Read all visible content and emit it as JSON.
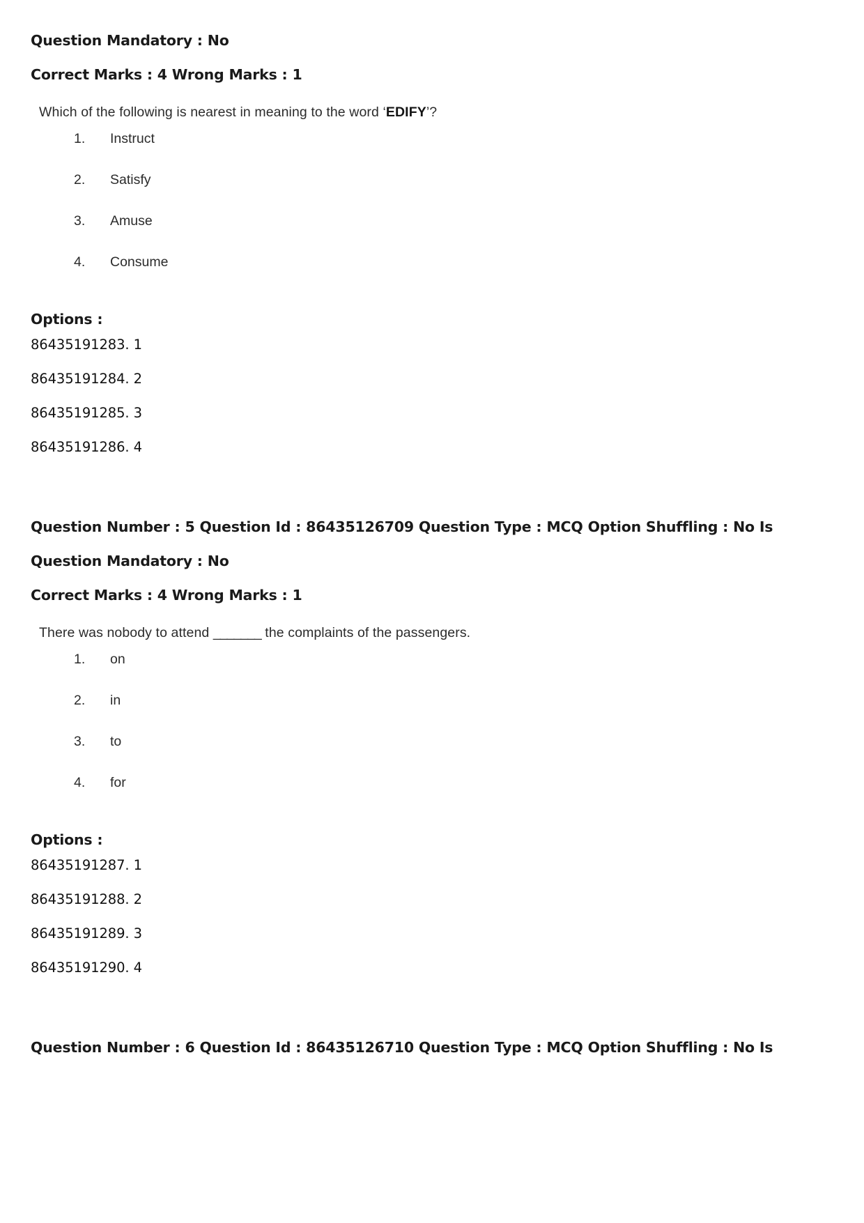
{
  "page": {
    "background": "#ffffff",
    "text_color": "#1a1a1a",
    "body_text_color": "#2b2b2b"
  },
  "questions": [
    {
      "mandatory_line": "Question Mandatory : No",
      "marks_line": "Correct Marks : 4 Wrong Marks : 1",
      "stem_prefix": "Which of the following is nearest in meaning to the word ‘",
      "stem_keyword": "EDIFY",
      "stem_suffix": "’?",
      "choices": [
        {
          "num": "1.",
          "text": "Instruct"
        },
        {
          "num": "2.",
          "text": "Satisfy"
        },
        {
          "num": "3.",
          "text": "Amuse"
        },
        {
          "num": "4.",
          "text": "Consume"
        }
      ],
      "options_heading": "Options :",
      "option_ids": [
        "86435191283. 1",
        "86435191284. 2",
        "86435191285. 3",
        "86435191286. 4"
      ]
    },
    {
      "header_line": "Question Number : 5 Question Id : 86435126709 Question Type : MCQ Option Shuffling : No Is",
      "mandatory_line": "Question Mandatory : No",
      "marks_line": "Correct Marks : 4 Wrong Marks : 1",
      "stem_prefix": "There was nobody to attend ",
      "stem_blank": "_______",
      "stem_suffix": " the complaints of the passengers.",
      "choices": [
        {
          "num": "1.",
          "text": "on"
        },
        {
          "num": "2.",
          "text": "in"
        },
        {
          "num": "3.",
          "text": "to"
        },
        {
          "num": "4.",
          "text": "for"
        }
      ],
      "options_heading": "Options :",
      "option_ids": [
        "86435191287. 1",
        "86435191288. 2",
        "86435191289. 3",
        "86435191290. 4"
      ]
    },
    {
      "header_line": "Question Number : 6 Question Id : 86435126710 Question Type : MCQ Option Shuffling : No Is"
    }
  ]
}
